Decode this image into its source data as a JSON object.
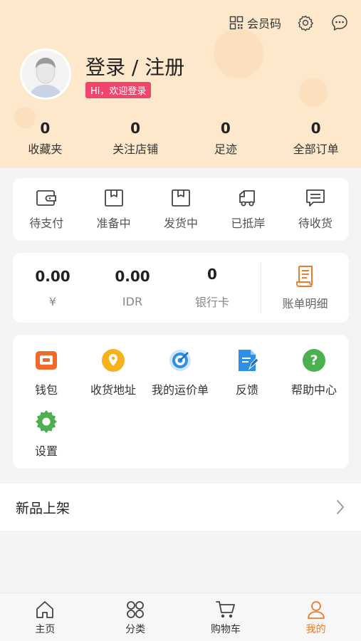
{
  "header": {
    "member_code": "会员码",
    "login_title": "登录 / 注册",
    "welcome": "Hi，欢迎登录"
  },
  "stats": [
    {
      "value": "0",
      "label": "收藏夹"
    },
    {
      "value": "0",
      "label": "关注店铺"
    },
    {
      "value": "0",
      "label": "足迹"
    },
    {
      "value": "0",
      "label": "全部订单"
    }
  ],
  "orders": [
    {
      "label": "待支付",
      "icon": "wallet-icon"
    },
    {
      "label": "准备中",
      "icon": "box-icon"
    },
    {
      "label": "发货中",
      "icon": "box-icon"
    },
    {
      "label": "已抵岸",
      "icon": "truck-icon"
    },
    {
      "label": "待收货",
      "icon": "message-icon"
    }
  ],
  "wallet": [
    {
      "value": "0.00",
      "label": "¥"
    },
    {
      "value": "0.00",
      "label": "IDR"
    },
    {
      "value": "0",
      "label": "银行卡"
    }
  ],
  "bill": {
    "label": "账单明细",
    "icon": "bill-icon"
  },
  "services": [
    {
      "label": "钱包",
      "icon": "wallet-icon",
      "color": "#f26a2b"
    },
    {
      "label": "收货地址",
      "icon": "location-icon",
      "color": "#f5b21d"
    },
    {
      "label": "我的运价单",
      "icon": "target-icon",
      "color": "#2e8fe6"
    },
    {
      "label": "反馈",
      "icon": "document-icon",
      "color": "#2e8fe6"
    },
    {
      "label": "帮助中心",
      "icon": "help-icon",
      "color": "#4caf50"
    },
    {
      "label": "设置",
      "icon": "gear-icon",
      "color": "#4caf50"
    }
  ],
  "new_arrivals": {
    "label": "新品上架"
  },
  "tabbar": [
    {
      "label": "主页",
      "icon": "home-icon"
    },
    {
      "label": "分类",
      "icon": "category-icon"
    },
    {
      "label": "购物车",
      "icon": "cart-icon"
    },
    {
      "label": "我的",
      "icon": "user-icon",
      "active": true
    }
  ],
  "colors": {
    "header_bg": "#fde8cc",
    "accent": "#f07b2c",
    "badge": "#f2456e"
  }
}
